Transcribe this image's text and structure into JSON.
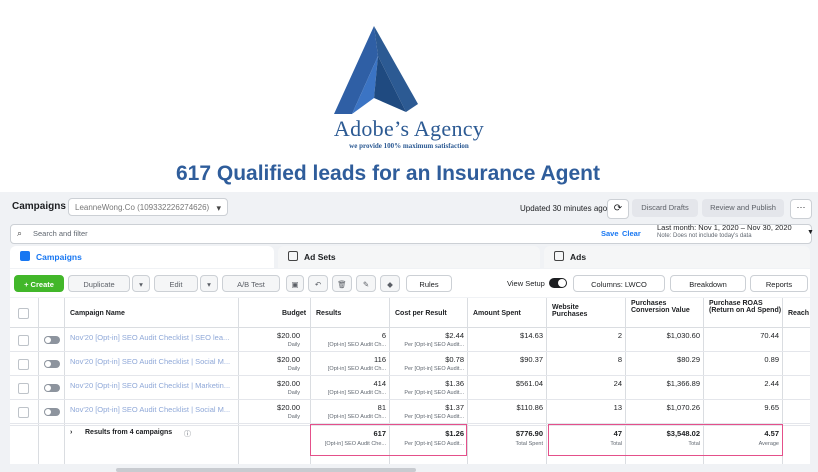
{
  "banner": {
    "agency_name": "Adobe’s Agency",
    "tagline": "we provide 100% maximum satisfaction",
    "headline": "617 Qualified leads for an Insurance Agent",
    "brand_color": "#2c5a93"
  },
  "topbar": {
    "title": "Campaigns",
    "account": "LeanneWong.Co (109332226274626)",
    "updated": "Updated 30 minutes ago",
    "discard": "Discard Drafts",
    "review": "Review and Publish",
    "more": "···"
  },
  "search": {
    "placeholder": "Search and filter",
    "save": "Save",
    "clear": "Clear",
    "date_range": "Last month: Nov 1, 2020 – Nov 30, 2020",
    "date_note": "Note: Does not include today's data"
  },
  "tabs": [
    "Campaigns",
    "Ad Sets",
    "Ads"
  ],
  "toolbar": {
    "create": "+ Create",
    "duplicate": "Duplicate",
    "edit": "Edit",
    "ab_test": "A/B Test",
    "rules": "Rules",
    "view_setup": "View Setup",
    "columns": "Columns: LWCO",
    "breakdown": "Breakdown",
    "reports": "Reports"
  },
  "table": {
    "headers": {
      "name": "Campaign Name",
      "budget": "Budget",
      "results": "Results",
      "cpr": "Cost per Result",
      "spent": "Amount Spent",
      "website_purchases": "Website Purchases",
      "pcv": "Purchases Conversion Value",
      "roas": "Purchase ROAS (Return on Ad Spend)",
      "reach": "Reach"
    },
    "rows": [
      {
        "name": "Nov'20 [Opt-in] SEO Audit Checklist | SEO lea...",
        "budget": "$20.00",
        "budget_sub": "Daily",
        "results": "6",
        "results_sub": "[Opt-in] SEO Audit Ch...",
        "cpr": "$2.44",
        "cpr_sub": "Per [Opt-in] SEO Audit...",
        "spent": "$14.63",
        "wp": "2",
        "pcv": "$1,030.60",
        "roas": "70.44"
      },
      {
        "name": "Nov'20 [Opt-in] SEO Audit Checklist | Social M...",
        "budget": "$20.00",
        "budget_sub": "Daily",
        "results": "116",
        "results_sub": "[Opt-in] SEO Audit Ch...",
        "cpr": "$0.78",
        "cpr_sub": "Per [Opt-in] SEO Audit...",
        "spent": "$90.37",
        "wp": "8",
        "pcv": "$80.29",
        "roas": "0.89"
      },
      {
        "name": "Nov'20 [Opt-in] SEO Audit Checklist | Marketin...",
        "budget": "$20.00",
        "budget_sub": "Daily",
        "results": "414",
        "results_sub": "[Opt-in] SEO Audit Ch...",
        "cpr": "$1.36",
        "cpr_sub": "Per [Opt-in] SEO Audit...",
        "spent": "$561.04",
        "wp": "24",
        "pcv": "$1,366.89",
        "roas": "2.44"
      },
      {
        "name": "Nov'20 [Opt-in] SEO Audit Checklist | Social M...",
        "budget": "$20.00",
        "budget_sub": "Daily",
        "results": "81",
        "results_sub": "[Opt-in] SEO Audit Ch...",
        "cpr": "$1.37",
        "cpr_sub": "Per [Opt-in] SEO Audit...",
        "spent": "$110.86",
        "wp": "13",
        "pcv": "$1,070.26",
        "roas": "9.65"
      }
    ],
    "total": {
      "label": "Results from 4 campaigns",
      "results": "617",
      "results_sub": "[Opt-in] SEO Audit Che...",
      "cpr": "$1.26",
      "cpr_sub": "Per [Opt-in] SEO Audit...",
      "spent": "$776.90",
      "spent_sub": "Total Spent",
      "wp": "47",
      "wp_sub": "Total",
      "pcv": "$3,548.02",
      "pcv_sub": "Total",
      "roas": "4.57",
      "roas_sub": "Average"
    }
  }
}
